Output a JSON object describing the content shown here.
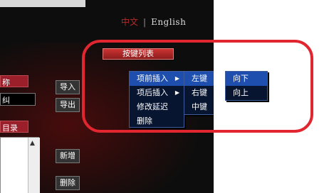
{
  "language": {
    "chinese": "中文",
    "separator": "|",
    "english": "English"
  },
  "left_panel": {
    "tab_top": "称",
    "field_text": "纠",
    "tab_bottom": "目录"
  },
  "buttons": {
    "import": "导入",
    "export": "导出",
    "add": "新增",
    "delete": "删除"
  },
  "key_list_label": "按键列表",
  "context_menu": {
    "items": [
      {
        "label": "项前插入",
        "has_submenu": true,
        "highlighted": true
      },
      {
        "label": "项后插入",
        "has_submenu": true,
        "highlighted": false
      },
      {
        "label": "修改延迟",
        "has_submenu": false,
        "highlighted": false
      },
      {
        "label": "删除",
        "has_submenu": false,
        "highlighted": false
      }
    ]
  },
  "key_submenu": {
    "items": [
      {
        "label": "左键",
        "highlighted": true
      },
      {
        "label": "右键",
        "highlighted": false
      },
      {
        "label": "中键",
        "highlighted": false
      }
    ]
  },
  "direction_submenu": {
    "items": [
      {
        "label": "向下",
        "highlighted": true
      },
      {
        "label": "向上",
        "highlighted": false
      }
    ]
  },
  "arrow_glyph": "▶",
  "scroll_up_glyph": "▲",
  "colors": {
    "accent_red": "#e1262f",
    "menu_bg": "#071530",
    "menu_highlight": "#1f4fae"
  }
}
